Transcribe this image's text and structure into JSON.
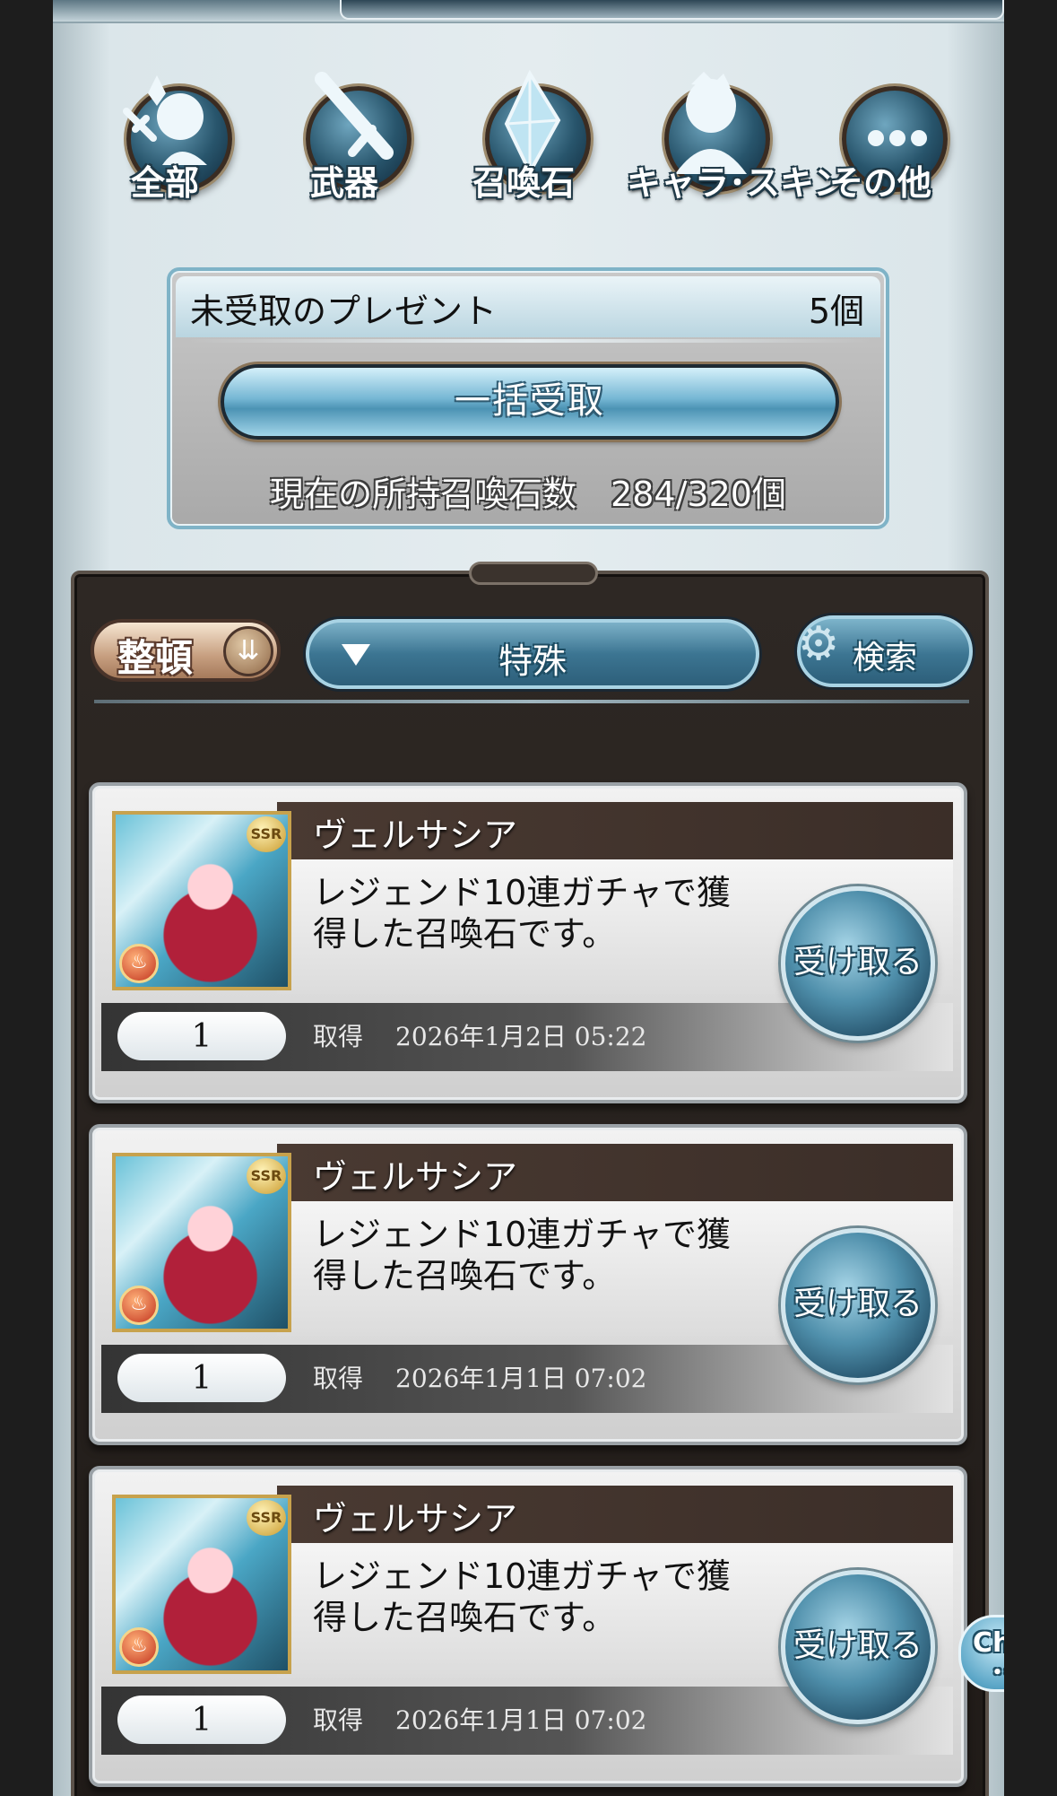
{
  "categories": [
    {
      "label": "全部",
      "icon": "all-items-icon"
    },
    {
      "label": "武器",
      "icon": "sword-icon"
    },
    {
      "label": "召喚石",
      "icon": "crystal-icon"
    },
    {
      "label": "キャラ･スキン",
      "icon": "character-icon"
    },
    {
      "label": "その他",
      "icon": "more-dots-icon"
    }
  ],
  "summary": {
    "title": "未受取のプレゼント",
    "count": "5個",
    "receive_all_label": "一括受取",
    "stock_text": "現在の所持召喚石数　284/320個"
  },
  "toolbar": {
    "sort_label": "整頓",
    "filter_label": "特殊",
    "search_label": "検索"
  },
  "items": [
    {
      "name": "ヴェルサシア",
      "description": "レジェンド10連ガチャで獲得した召喚石です。",
      "quantity": "1",
      "acquired_label": "取得",
      "acquired_date": "2026年1月2日 05:22",
      "receive_label": "受け取る",
      "rarity": "SSR"
    },
    {
      "name": "ヴェルサシア",
      "description": "レジェンド10連ガチャで獲得した召喚石です。",
      "quantity": "1",
      "acquired_label": "取得",
      "acquired_date": "2026年1月1日 07:02",
      "receive_label": "受け取る",
      "rarity": "SSR"
    },
    {
      "name": "ヴェルサシア",
      "description": "レジェンド10連ガチャで獲得した召喚石です。",
      "quantity": "1",
      "acquired_label": "取得",
      "acquired_date": "2026年1月1日 07:02",
      "receive_label": "受け取る",
      "rarity": "SSR"
    }
  ],
  "chat": {
    "label": "Chat",
    "dots": "•••"
  },
  "colors": {
    "accent": "#4f8fab",
    "panel": "#2e2824",
    "rarity": "#c99a2c"
  }
}
